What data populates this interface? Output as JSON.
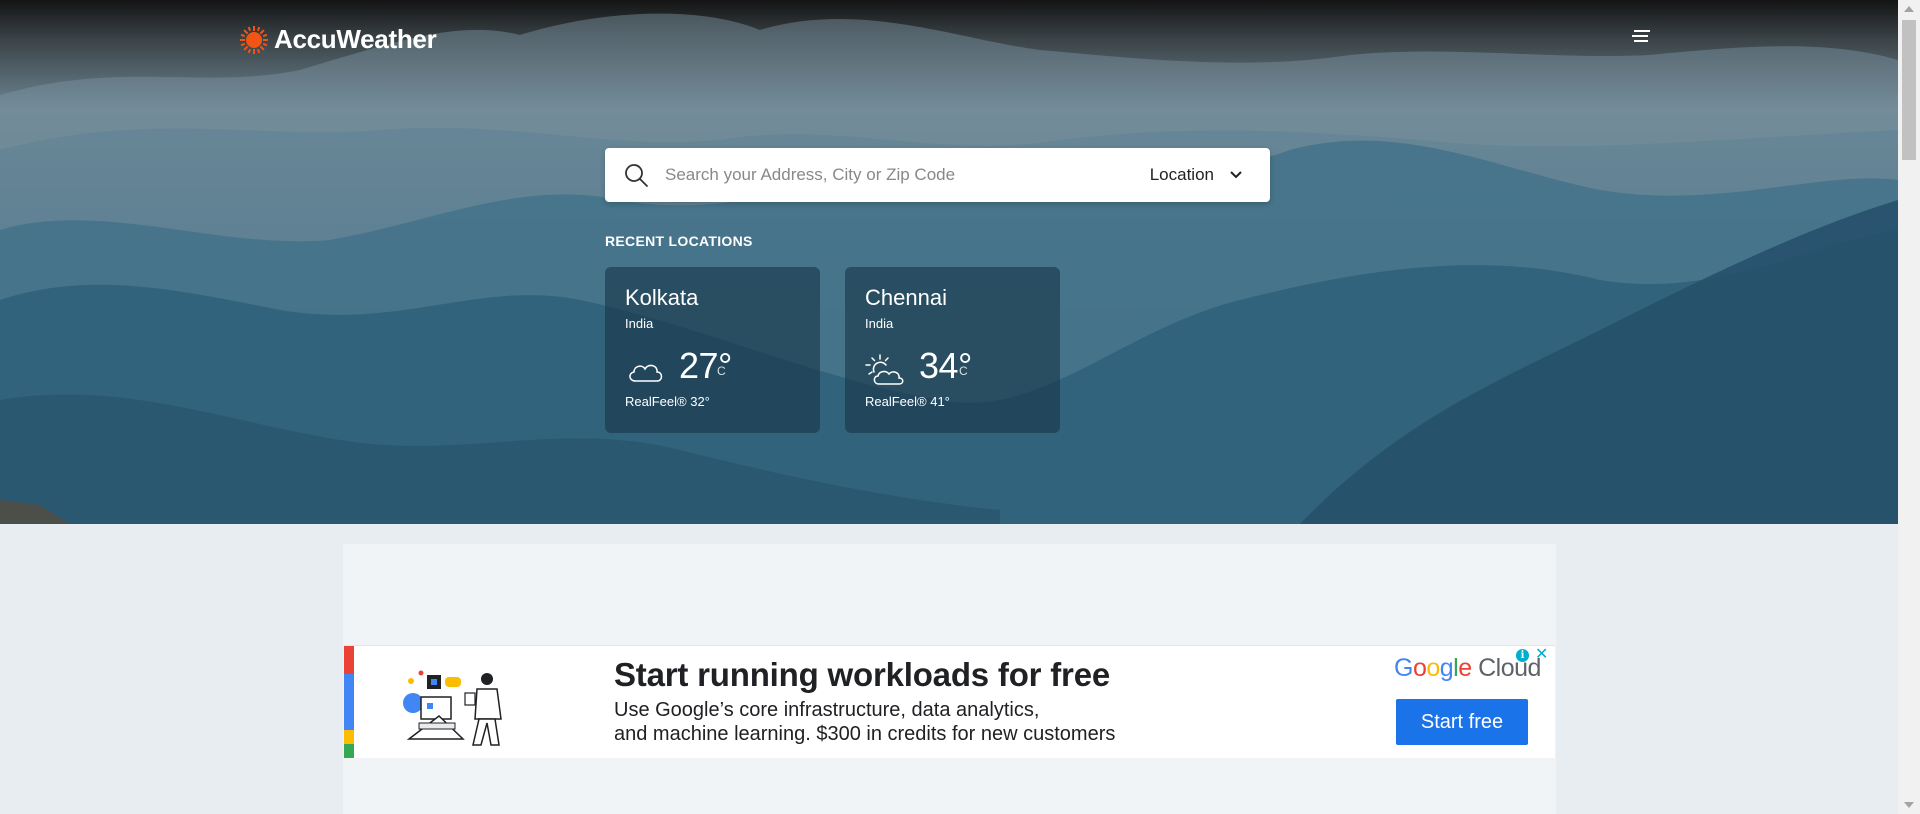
{
  "header": {
    "logo_text": "AccuWeather",
    "logo_icon": "sun-icon",
    "menu_icon": "hamburger-menu-icon"
  },
  "search": {
    "placeholder": "Search your Address, City or Zip Code",
    "value": "",
    "location_label": "Location",
    "search_icon": "search-icon",
    "chevron_icon": "chevron-down-icon"
  },
  "recent": {
    "label": "RECENT LOCATIONS",
    "cards": [
      {
        "city": "Kolkata",
        "country": "India",
        "temp": "27°",
        "unit": "C",
        "realfeel": "RealFeel® 32°",
        "icon": "cloudy-icon"
      },
      {
        "city": "Chennai",
        "country": "India",
        "temp": "34°",
        "unit": "C",
        "realfeel": "RealFeel® 41°",
        "icon": "partly-sunny-icon"
      }
    ]
  },
  "ad": {
    "headline": "Start running workloads for free",
    "body_line1": "Use Google’s core infrastructure, data analytics,",
    "body_line2": "and machine learning. $300 in credits for new customers",
    "brand": "Google Cloud",
    "cta": "Start free",
    "info_icon": "info-icon",
    "close_icon": "close-icon",
    "colors": {
      "blue": "#4285f4",
      "red": "#ea4335",
      "yellow": "#fbbc04",
      "green": "#34a853",
      "cta": "#1a73e8"
    }
  },
  "colors": {
    "brand_orange": "#f05514",
    "page_bg": "#e8edf2"
  }
}
